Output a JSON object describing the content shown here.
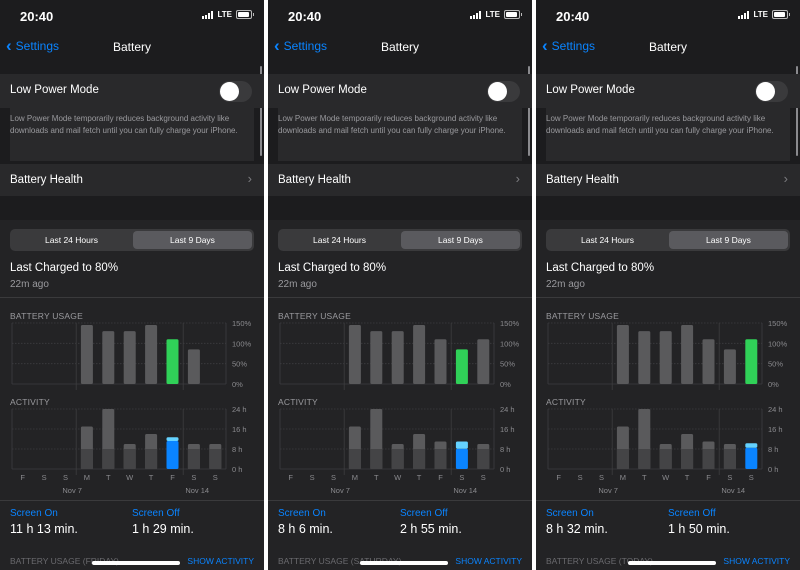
{
  "colors": {
    "blue": "#0a84ff",
    "green": "#30d158",
    "blue_bar": "#0a84ff",
    "blue_bar_light": "#64d2ff",
    "gray_bar": "#5a5a5c",
    "dim_bar": "#444446"
  },
  "chart_axis": {
    "usage_ticks": [
      "150%",
      "100%",
      "50%",
      "0%"
    ],
    "activity_ticks": [
      "24 h",
      "16 h",
      "8 h",
      "0 h"
    ],
    "days": [
      "F",
      "S",
      "S",
      "M",
      "T",
      "W",
      "T",
      "F",
      "S",
      "S"
    ],
    "date_left": "Nov 7",
    "date_right": "Nov 14"
  },
  "screens": [
    {
      "status": {
        "time": "20:40",
        "network": "LTE"
      },
      "nav": {
        "back_label": "Settings",
        "title": "Battery"
      },
      "low_power": {
        "label": "Low Power Mode",
        "description": "Low Power Mode temporarily reduces background activity like downloads and mail fetch until you can fully charge your iPhone.",
        "enabled": false
      },
      "battery_health": {
        "label": "Battery Health"
      },
      "segmented": {
        "left": "Last 24 Hours",
        "right": "Last 9 Days",
        "selected": "right"
      },
      "last_charged": {
        "title": "Last Charged to 80%",
        "ago": "22m ago"
      },
      "usage_label": "BATTERY USAGE",
      "activity_label": "ACTIVITY",
      "screen_on": {
        "label": "Screen On",
        "value": "11 h 13 min."
      },
      "screen_off": {
        "label": "Screen Off",
        "value": "1 h 29 min."
      },
      "bottom": {
        "left": "BATTERY USAGE (FRIDAY)",
        "right": "SHOW ACTIVITY"
      },
      "selected_day": 7
    },
    {
      "status": {
        "time": "20:40",
        "network": "LTE"
      },
      "nav": {
        "back_label": "Settings",
        "title": "Battery"
      },
      "low_power": {
        "label": "Low Power Mode",
        "description": "Low Power Mode temporarily reduces background activity like downloads and mail fetch until you can fully charge your iPhone.",
        "enabled": false
      },
      "battery_health": {
        "label": "Battery Health"
      },
      "segmented": {
        "left": "Last 24 Hours",
        "right": "Last 9 Days",
        "selected": "right"
      },
      "last_charged": {
        "title": "Last Charged to 80%",
        "ago": "22m ago"
      },
      "usage_label": "BATTERY USAGE",
      "activity_label": "ACTIVITY",
      "screen_on": {
        "label": "Screen On",
        "value": "8 h 6 min."
      },
      "screen_off": {
        "label": "Screen Off",
        "value": "2 h 55 min."
      },
      "bottom": {
        "left": "BATTERY USAGE (SATURDAY)",
        "right": "SHOW ACTIVITY"
      },
      "selected_day": 8
    },
    {
      "status": {
        "time": "20:40",
        "network": "LTE"
      },
      "nav": {
        "back_label": "Settings",
        "title": "Battery"
      },
      "low_power": {
        "label": "Low Power Mode",
        "description": "Low Power Mode temporarily reduces background activity like downloads and mail fetch until you can fully charge your iPhone.",
        "enabled": false
      },
      "battery_health": {
        "label": "Battery Health"
      },
      "segmented": {
        "left": "Last 24 Hours",
        "right": "Last 9 Days",
        "selected": "right"
      },
      "last_charged": {
        "title": "Last Charged to 80%",
        "ago": "22m ago"
      },
      "usage_label": "BATTERY USAGE",
      "activity_label": "ACTIVITY",
      "screen_on": {
        "label": "Screen On",
        "value": "8 h 32 min."
      },
      "screen_off": {
        "label": "Screen Off",
        "value": "1 h 50 min."
      },
      "bottom": {
        "left": "BATTERY USAGE (TODAY)",
        "right": "SHOW ACTIVITY"
      },
      "selected_day": 9
    }
  ],
  "chart_data": [
    {
      "type": "bar",
      "title": "BATTERY USAGE",
      "categories": [
        "F",
        "S",
        "S",
        "M",
        "T",
        "W",
        "T",
        "F",
        "S",
        "S"
      ],
      "ylim": [
        0,
        150
      ],
      "ylabel": "",
      "series": [
        {
          "values": [
            0,
            0,
            0,
            145,
            130,
            130,
            145,
            110,
            85,
            0
          ]
        }
      ],
      "highlighted_index": 7
    },
    {
      "type": "bar",
      "title": "ACTIVITY",
      "categories": [
        "F",
        "S",
        "S",
        "M",
        "T",
        "W",
        "T",
        "F",
        "S",
        "S"
      ],
      "ylim": [
        0,
        24
      ],
      "series": [
        {
          "name": "Screen On",
          "values": [
            0,
            0,
            0,
            17,
            24,
            10,
            14,
            11.2,
            10,
            10
          ]
        },
        {
          "name": "Screen Off",
          "values": [
            0,
            0,
            0,
            0,
            0,
            0,
            0,
            1.5,
            0,
            0
          ]
        }
      ],
      "highlighted_index": 7
    },
    {
      "type": "bar",
      "title": "BATTERY USAGE",
      "categories": [
        "F",
        "S",
        "S",
        "M",
        "T",
        "W",
        "T",
        "F",
        "S",
        "S"
      ],
      "ylim": [
        0,
        150
      ],
      "series": [
        {
          "values": [
            0,
            0,
            0,
            145,
            130,
            130,
            145,
            110,
            85,
            110
          ]
        }
      ],
      "highlighted_index": 8
    },
    {
      "type": "bar",
      "title": "ACTIVITY",
      "categories": [
        "F",
        "S",
        "S",
        "M",
        "T",
        "W",
        "T",
        "F",
        "S",
        "S"
      ],
      "ylim": [
        0,
        24
      ],
      "series": [
        {
          "name": "Screen On",
          "values": [
            0,
            0,
            0,
            17,
            24,
            10,
            14,
            11,
            8.1,
            10
          ]
        },
        {
          "name": "Screen Off",
          "values": [
            0,
            0,
            0,
            0,
            0,
            0,
            0,
            0,
            2.9,
            0
          ]
        }
      ],
      "highlighted_index": 8
    },
    {
      "type": "bar",
      "title": "BATTERY USAGE",
      "categories": [
        "F",
        "S",
        "S",
        "M",
        "T",
        "W",
        "T",
        "F",
        "S",
        "S"
      ],
      "ylim": [
        0,
        150
      ],
      "series": [
        {
          "values": [
            0,
            0,
            0,
            145,
            130,
            130,
            145,
            110,
            85,
            110
          ]
        }
      ],
      "highlighted_index": 9
    },
    {
      "type": "bar",
      "title": "ACTIVITY",
      "categories": [
        "F",
        "S",
        "S",
        "M",
        "T",
        "W",
        "T",
        "F",
        "S",
        "S"
      ],
      "ylim": [
        0,
        24
      ],
      "series": [
        {
          "name": "Screen On",
          "values": [
            0,
            0,
            0,
            17,
            24,
            10,
            14,
            11,
            10,
            8.5
          ]
        },
        {
          "name": "Screen Off",
          "values": [
            0,
            0,
            0,
            0,
            0,
            0,
            0,
            0,
            0,
            1.8
          ]
        }
      ],
      "highlighted_index": 9
    }
  ]
}
